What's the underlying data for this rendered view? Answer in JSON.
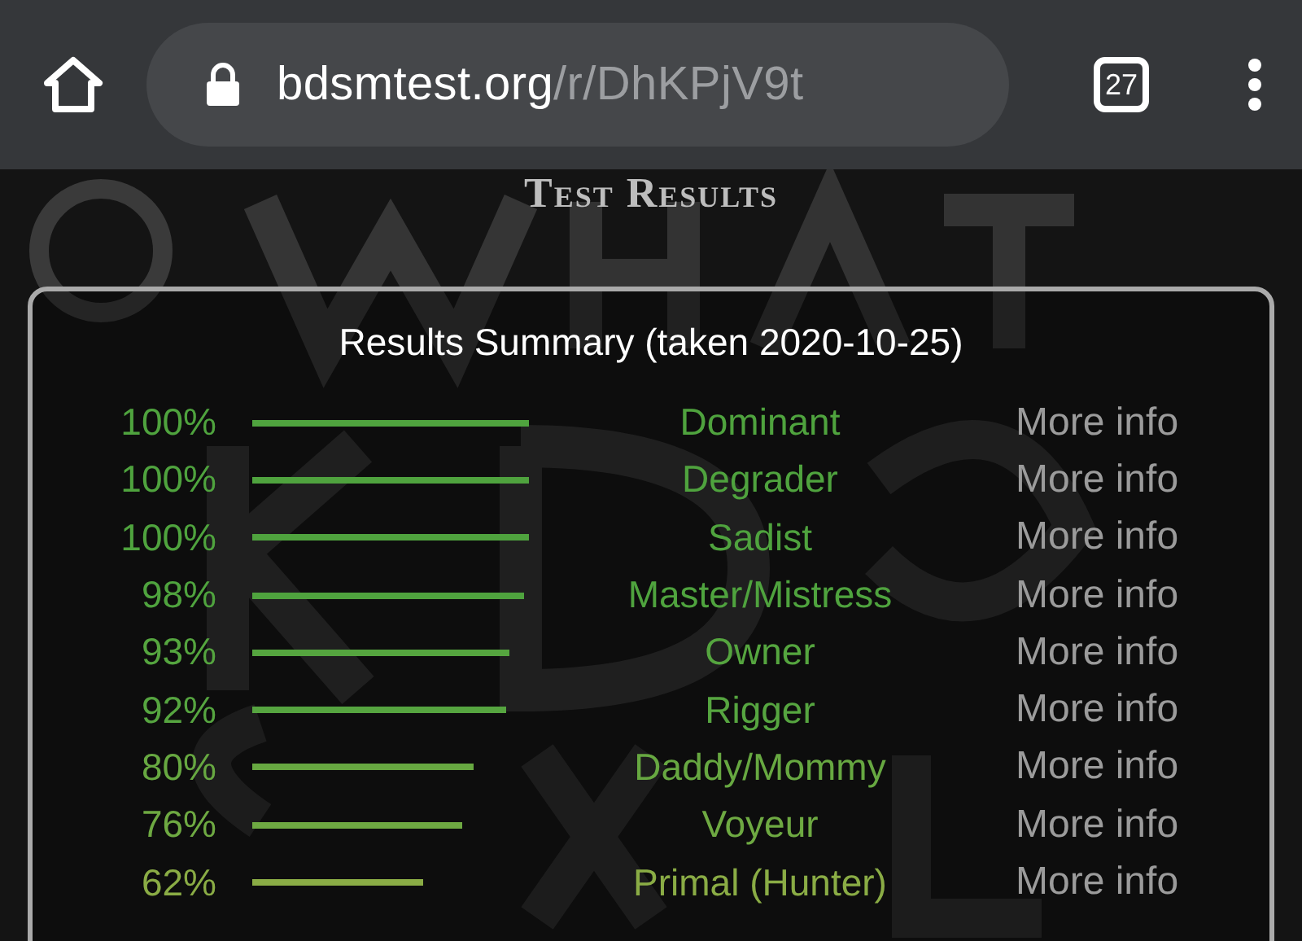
{
  "browser": {
    "url_host": "bdsmtest.org",
    "url_path": "/r/DhKPjV9t",
    "tab_count": "27"
  },
  "page": {
    "heading": "Test Results",
    "summary_title": "Results Summary (taken 2020-10-25)",
    "results": [
      {
        "percent": "100%",
        "name": "Dominant",
        "link": "More info",
        "color": "#4fa33e"
      },
      {
        "percent": "100%",
        "name": "Degrader",
        "link": "More info",
        "color": "#4fa33e"
      },
      {
        "percent": "100%",
        "name": "Sadist",
        "link": "More info",
        "color": "#4fa33e"
      },
      {
        "percent": "98%",
        "name": "Master/Mistress",
        "link": "More info",
        "color": "#4fa33e"
      },
      {
        "percent": "93%",
        "name": "Owner",
        "link": "More info",
        "color": "#55a53f"
      },
      {
        "percent": "92%",
        "name": "Rigger",
        "link": "More info",
        "color": "#56a540"
      },
      {
        "percent": "80%",
        "name": "Daddy/Mommy",
        "link": "More info",
        "color": "#67a841"
      },
      {
        "percent": "76%",
        "name": "Voyeur",
        "link": "More info",
        "color": "#6ea942"
      },
      {
        "percent": "62%",
        "name": "Primal (Hunter)",
        "link": "More info",
        "color": "#8aac45"
      }
    ]
  }
}
